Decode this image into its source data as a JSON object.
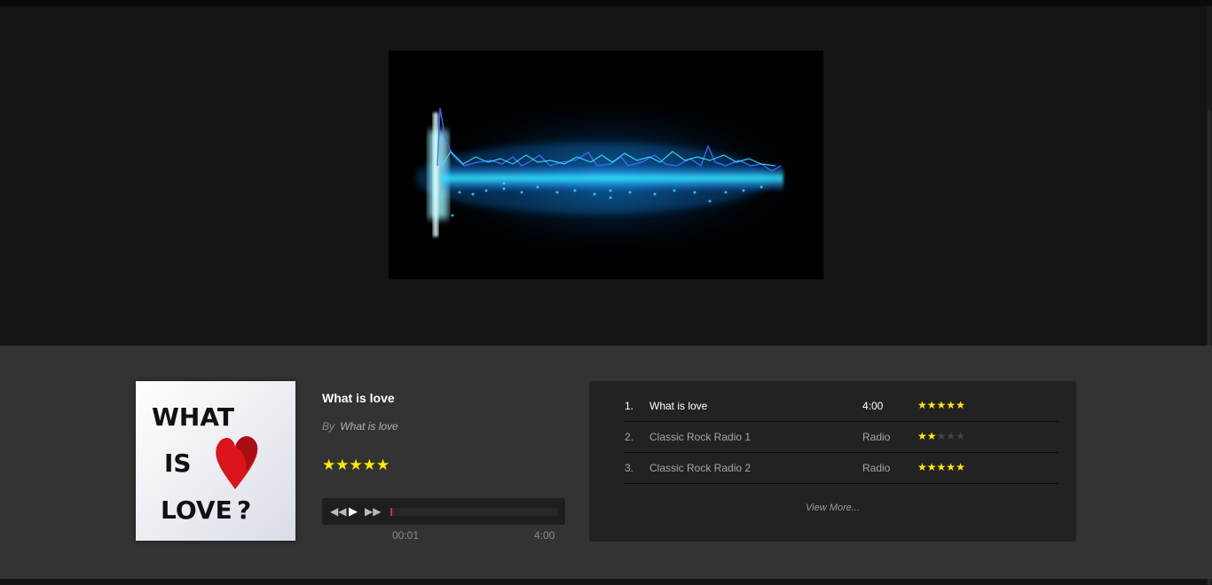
{
  "track": {
    "title": "What is love",
    "by_label": "By",
    "artist": "What is love",
    "rating_stars": "★★★★★",
    "rating": 5
  },
  "player": {
    "rewind_icon": "rewind-icon",
    "play_icon": "play-icon",
    "forward_icon": "fast-forward-icon",
    "progress": 0.005,
    "current_time": "00:01",
    "duration": "4:00"
  },
  "cover": {
    "line1": "WHAT",
    "line2": "IS",
    "line3": "LOVE",
    "punct": "?"
  },
  "playlist": {
    "items": [
      {
        "num": "1.",
        "name": "What is love",
        "length": "4:00",
        "rating": 5,
        "active": true
      },
      {
        "num": "2.",
        "name": "Classic Rock Radio 1",
        "length": "Radio",
        "rating": 2,
        "active": false
      },
      {
        "num": "3.",
        "name": "Classic Rock Radio 2",
        "length": "Radio",
        "rating": 5,
        "active": false
      }
    ],
    "view_more": "View More..."
  },
  "colors": {
    "star": "#ffea00",
    "progress": "#d0304a",
    "wave": "#22d3ff"
  }
}
